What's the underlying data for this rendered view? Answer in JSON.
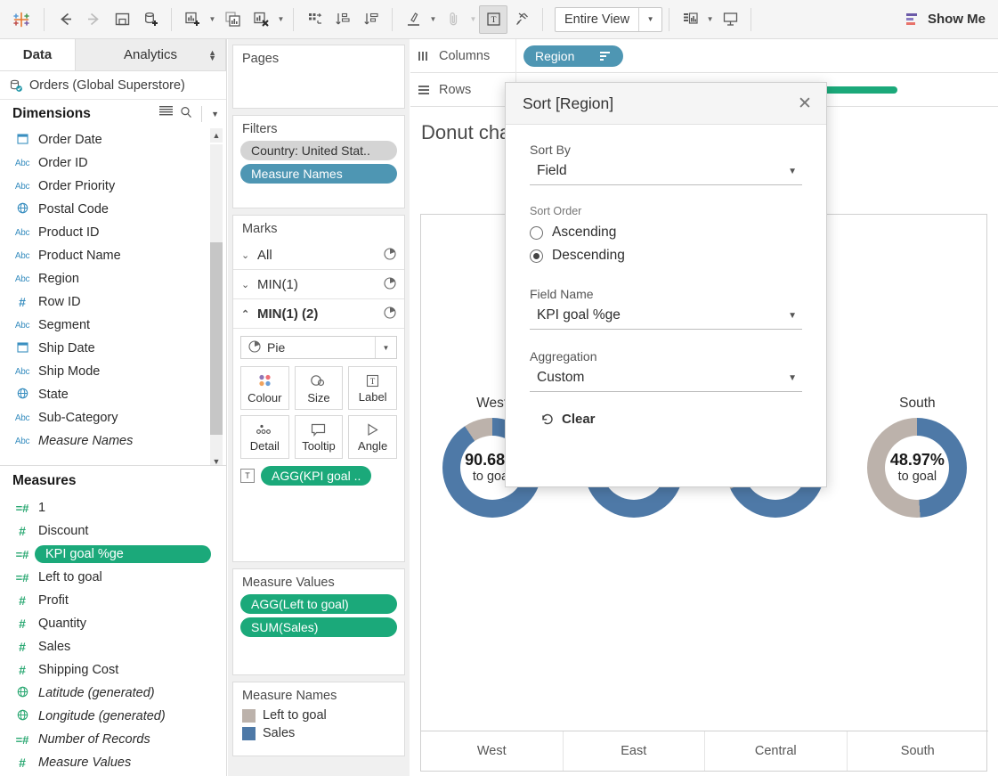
{
  "toolbar": {
    "logo_icon": "tableau-logo-icon",
    "buttons": [
      {
        "name": "back-button",
        "icon": "arrow-left-icon",
        "label": "Back",
        "disabled": false
      },
      {
        "name": "forward-button",
        "icon": "arrow-right-icon",
        "label": "Forward",
        "disabled": true
      },
      {
        "name": "save-button",
        "icon": "save-icon",
        "label": "Save"
      },
      {
        "name": "new-data-source-button",
        "icon": "database-plus-icon",
        "label": "New Data Source"
      },
      {
        "name": "new-worksheet-button",
        "icon": "chart-plus-icon",
        "label": "New Worksheet"
      },
      {
        "name": "duplicate-sheet-button",
        "icon": "duplicate-sheet-icon",
        "label": "Duplicate Sheet"
      },
      {
        "name": "clear-sheet-button",
        "icon": "chart-clear-icon",
        "label": "Clear Sheet"
      },
      {
        "name": "swap-rows-columns-button",
        "icon": "swap-icon",
        "label": "Swap Rows and Columns"
      },
      {
        "name": "sort-ascending-button",
        "icon": "sort-asc-icon",
        "label": "Sort Ascending"
      },
      {
        "name": "sort-descending-button",
        "icon": "sort-desc-icon",
        "label": "Sort Descending"
      },
      {
        "name": "highlight-button",
        "icon": "highlighter-icon",
        "label": "Highlight"
      },
      {
        "name": "group-members-button",
        "icon": "paperclip-icon",
        "label": "Group Members",
        "disabled": true
      },
      {
        "name": "show-mark-labels-button",
        "icon": "text-label-icon",
        "label": "Show Mark Labels",
        "active": true
      },
      {
        "name": "fix-axes-button",
        "icon": "pin-icon",
        "label": "Fix Axes"
      },
      {
        "name": "show-hide-cards-button",
        "icon": "cards-icon",
        "label": "Show/Hide Cards"
      },
      {
        "name": "presentation-mode-button",
        "icon": "presentation-icon",
        "label": "Presentation Mode"
      }
    ],
    "view_size": {
      "label": "Entire View",
      "caret": "chevron-down-icon"
    },
    "show_me": {
      "label": "Show Me",
      "icon": "show-me-icon"
    }
  },
  "data_pane": {
    "tabs": [
      {
        "label": "Data",
        "selected": true
      },
      {
        "label": "Analytics",
        "selected": false
      }
    ],
    "data_source": {
      "label": "Orders (Global Superstore)",
      "icon": "data-source-icon"
    },
    "dimensions": {
      "title": "Dimensions",
      "tools": [
        "view-data-icon",
        "search-icon",
        "chevron-down-icon"
      ],
      "items": [
        {
          "label": "Order Date",
          "icon": "date-icon",
          "type": "date",
          "italic": false
        },
        {
          "label": "Order ID",
          "icon": "abc-icon",
          "type": "string",
          "italic": false
        },
        {
          "label": "Order Priority",
          "icon": "abc-icon",
          "type": "string",
          "italic": false
        },
        {
          "label": "Postal Code",
          "icon": "geo-icon",
          "type": "geo",
          "italic": false
        },
        {
          "label": "Product ID",
          "icon": "abc-icon",
          "type": "string",
          "italic": false
        },
        {
          "label": "Product Name",
          "icon": "abc-icon",
          "type": "string",
          "italic": false
        },
        {
          "label": "Region",
          "icon": "abc-icon",
          "type": "string",
          "italic": false
        },
        {
          "label": "Row ID",
          "icon": "number-icon",
          "type": "number",
          "italic": false
        },
        {
          "label": "Segment",
          "icon": "abc-icon",
          "type": "string",
          "italic": false
        },
        {
          "label": "Ship Date",
          "icon": "date-icon",
          "type": "date",
          "italic": false
        },
        {
          "label": "Ship Mode",
          "icon": "abc-icon",
          "type": "string",
          "italic": false
        },
        {
          "label": "State",
          "icon": "geo-icon",
          "type": "geo",
          "italic": false
        },
        {
          "label": "Sub-Category",
          "icon": "abc-icon",
          "type": "string",
          "italic": false
        },
        {
          "label": "Measure Names",
          "icon": "abc-icon",
          "type": "string",
          "italic": true
        }
      ]
    },
    "measures": {
      "title": "Measures",
      "items": [
        {
          "label": "1",
          "icon": "calculated-number-icon",
          "italic": false,
          "selected": false
        },
        {
          "label": "Discount",
          "icon": "number-icon",
          "italic": false,
          "selected": false
        },
        {
          "label": "KPI goal %ge",
          "icon": "calculated-number-icon",
          "italic": false,
          "selected": true
        },
        {
          "label": "Left to goal",
          "icon": "calculated-number-icon",
          "italic": false,
          "selected": false
        },
        {
          "label": "Profit",
          "icon": "number-icon",
          "italic": false,
          "selected": false
        },
        {
          "label": "Quantity",
          "icon": "number-icon",
          "italic": false,
          "selected": false
        },
        {
          "label": "Sales",
          "icon": "number-icon",
          "italic": false,
          "selected": false
        },
        {
          "label": "Shipping Cost",
          "icon": "number-icon",
          "italic": false,
          "selected": false
        },
        {
          "label": "Latitude (generated)",
          "icon": "geo-icon",
          "italic": true,
          "selected": false
        },
        {
          "label": "Longitude (generated)",
          "icon": "geo-icon",
          "italic": true,
          "selected": false
        },
        {
          "label": "Number of Records",
          "icon": "calculated-number-icon",
          "italic": true,
          "selected": false
        },
        {
          "label": "Measure Values",
          "icon": "number-icon",
          "italic": true,
          "selected": false
        }
      ]
    }
  },
  "pages_card": {
    "title": "Pages",
    "items": []
  },
  "filters_card": {
    "title": "Filters",
    "items": [
      {
        "label": "Country: United Stat..",
        "color": "grey"
      },
      {
        "label": "Measure Names",
        "color": "blue"
      }
    ]
  },
  "marks_card": {
    "title": "Marks",
    "rows": [
      {
        "label": "All",
        "chevron": "chevron-down-icon",
        "icon": "pie-icon",
        "bold": false
      },
      {
        "label": "MIN(1)",
        "chevron": "chevron-down-icon",
        "icon": "pie-icon",
        "bold": false
      },
      {
        "label": "MIN(1) (2)",
        "chevron": "chevron-up-icon",
        "icon": "pie-icon",
        "bold": true
      }
    ],
    "mark_type": {
      "label": "Pie",
      "icon": "pie-icon",
      "caret": "chevron-down-icon"
    },
    "buttons": [
      {
        "label": "Colour",
        "icon": "colour-icon"
      },
      {
        "label": "Size",
        "icon": "size-icon"
      },
      {
        "label": "Label",
        "icon": "label-icon"
      },
      {
        "label": "Detail",
        "icon": "detail-icon"
      },
      {
        "label": "Tooltip",
        "icon": "tooltip-icon"
      },
      {
        "label": "Angle",
        "icon": "angle-icon"
      }
    ],
    "card_pills": [
      {
        "shelf_icon": "label-icon",
        "label": "AGG(KPI goal ..",
        "color": "green"
      }
    ]
  },
  "measure_values_card": {
    "title": "Measure Values",
    "items": [
      {
        "label": "AGG(Left to goal)",
        "color": "green"
      },
      {
        "label": "SUM(Sales)",
        "color": "green"
      }
    ]
  },
  "measure_names_legend": {
    "title": "Measure Names",
    "items": [
      {
        "label": "Left to goal",
        "colour": "#bcb2ab"
      },
      {
        "label": "Sales",
        "colour": "#4e79a7"
      }
    ]
  },
  "columns_shelf": {
    "label": "Columns",
    "icon": "columns-icon",
    "pills": [
      {
        "label": "Region",
        "color": "blue",
        "badge": "sort-icon"
      }
    ]
  },
  "rows_shelf": {
    "label": "Rows",
    "icon": "rows-icon",
    "pills": [
      {
        "label": "",
        "color": "green",
        "badge": ""
      }
    ]
  },
  "worksheet": {
    "title": "Donut chart"
  },
  "chart_data": {
    "type": "pie",
    "title": "Donut chart",
    "xlabel": "",
    "ylabel": "",
    "legend_position": "right-panel",
    "categories": [
      "West",
      "East",
      "Central",
      "South"
    ],
    "series": [
      {
        "name": "Sales",
        "colour": "#4e79a7",
        "values": [
          90.68,
          76.0,
          68.0,
          48.97
        ]
      },
      {
        "name": "Left to goal",
        "colour": "#bcb2ab",
        "values": [
          9.32,
          24.0,
          32.0,
          51.03
        ]
      }
    ],
    "annotations": [
      {
        "category": "West",
        "value_label": "90.68%",
        "sub_label": "to goal"
      },
      {
        "category": "East",
        "value_label": "",
        "sub_label": ""
      },
      {
        "category": "Central",
        "value_label": "",
        "sub_label": ""
      },
      {
        "category": "South",
        "value_label": "48.97%",
        "sub_label": "to goal"
      }
    ],
    "axis_ticks": [
      "West",
      "East",
      "Central",
      "South"
    ]
  },
  "sort_dialog": {
    "title": "Sort [Region]",
    "close_icon": "close-icon",
    "sort_by": {
      "label": "Sort By",
      "value": "Field",
      "caret": "chevron-down-icon"
    },
    "sort_order": {
      "label": "Sort Order",
      "options": [
        {
          "label": "Ascending",
          "selected": false
        },
        {
          "label": "Descending",
          "selected": true
        }
      ]
    },
    "field_name": {
      "label": "Field Name",
      "value": "KPI goal %ge",
      "caret": "chevron-down-icon"
    },
    "aggregation": {
      "label": "Aggregation",
      "value": "Custom",
      "caret": "chevron-down-icon"
    },
    "clear": {
      "label": "Clear",
      "icon": "undo-icon"
    }
  },
  "colours": {
    "tableau_green": "#1ba97a",
    "tableau_blue_pill": "#4e96b3",
    "donut_blue": "#4e79a7",
    "donut_grey": "#bcb2ab",
    "grey_pill": "#d4d4d4"
  }
}
